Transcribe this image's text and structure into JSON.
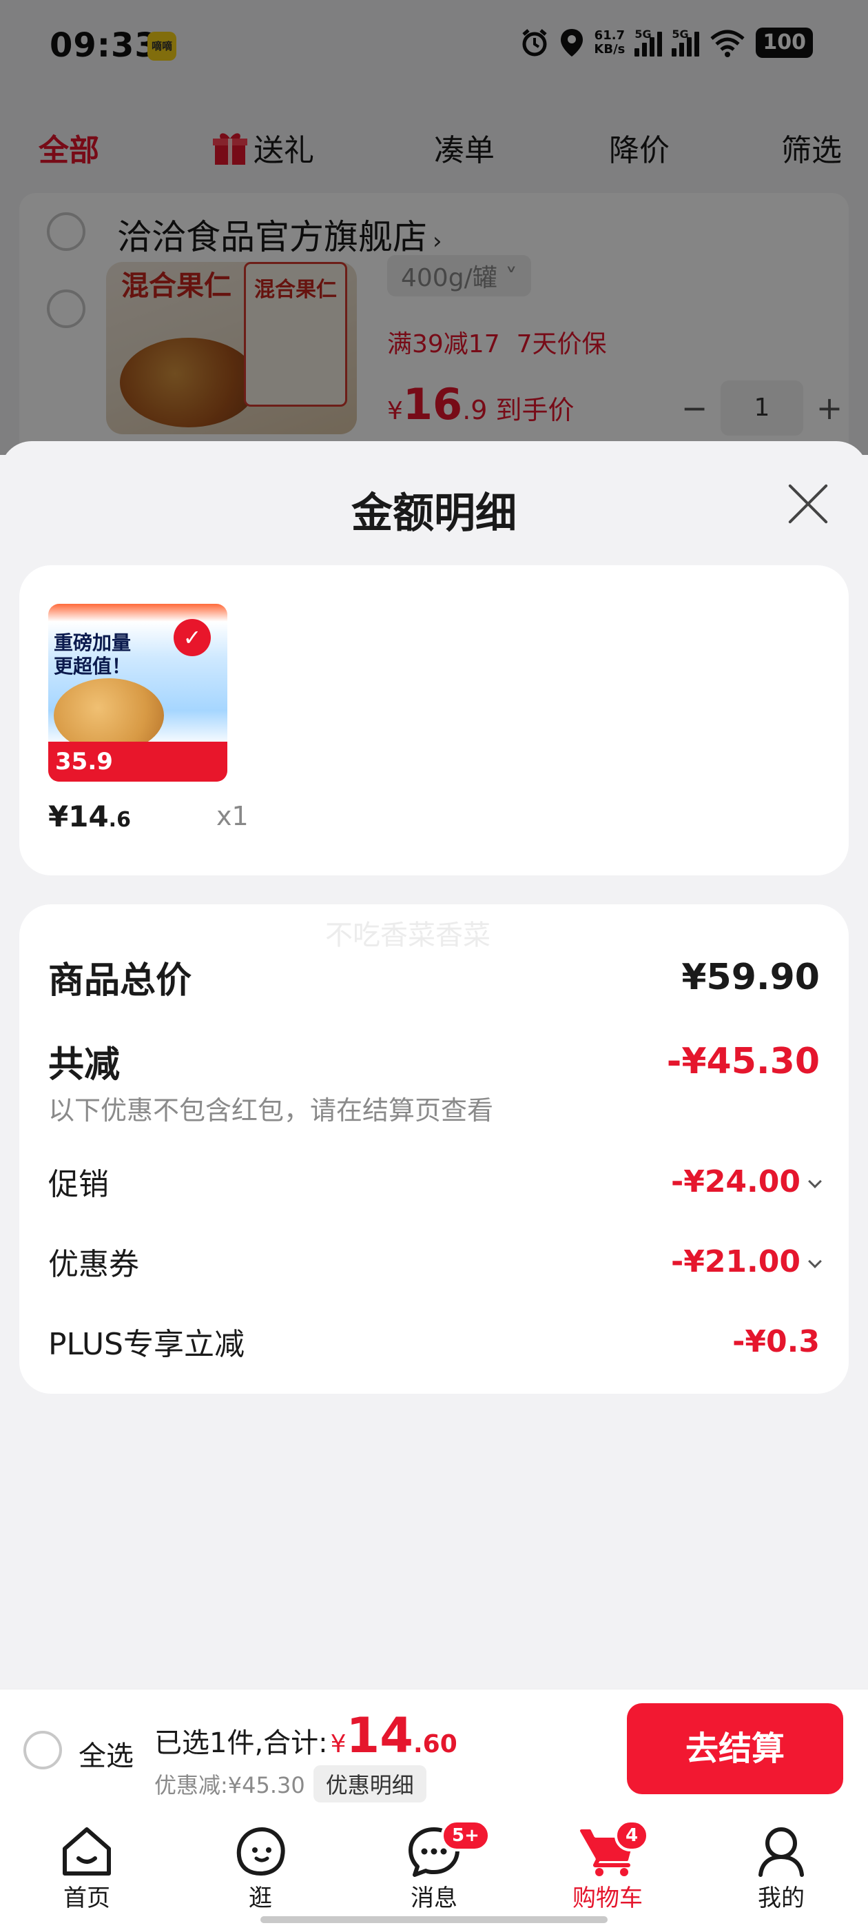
{
  "status_bar": {
    "time": "09:33",
    "app_icon_text": "嘀嘀",
    "net_speed_value": "61.7",
    "net_speed_unit": "KB/s",
    "sim1": "5G",
    "sim2": "5G",
    "battery": "100"
  },
  "filters": {
    "all": "全部",
    "gift": "送礼",
    "bundle": "凑单",
    "price_drop": "降价",
    "screen": "筛选"
  },
  "cart": {
    "store_name": "洽洽食品官方旗舰店",
    "product_image_text": "混合果仁",
    "product_jar_text": "混合果仁",
    "spec": "400g/罐",
    "promo": "满39减17",
    "price_protect": "7天价保",
    "price_currency": "¥",
    "price_int": "16",
    "price_dec": ".9",
    "price_tag": "到手价",
    "quantity": "1"
  },
  "sheet": {
    "title": "金额明细",
    "watermark": "不吃香菜香菜",
    "goods": {
      "thumb_headline_1": "重磅加量",
      "thumb_headline_2": "更超值！",
      "thumb_price": "35.9",
      "price_int": "¥14",
      "price_dec": ".6",
      "qty": "x1"
    },
    "total_label": "商品总价",
    "total_value": "¥59.90",
    "discount_label": "共减",
    "discount_value": "-¥45.30",
    "note": "以下优惠不包含红包，请在结算页查看",
    "promo_label": "促销",
    "promo_value": "-¥24.00",
    "coupon_label": "优惠券",
    "coupon_value": "-¥21.00",
    "plus_label": "PLUS专享立减",
    "plus_value": "-¥0.3"
  },
  "checkout": {
    "select_all": "全选",
    "selected_text": "已选1件,合计:",
    "currency": "¥",
    "total_int": "14",
    "total_dec": ".60",
    "saved_text": "优惠减:¥45.30",
    "detail_link": "优惠明细",
    "button": "去结算"
  },
  "tabbar": {
    "home": "首页",
    "browse": "逛",
    "messages": "消息",
    "messages_badge": "5+",
    "cart": "购物车",
    "cart_badge": "4",
    "me": "我的"
  },
  "colors": {
    "accent_red": "#e5162d",
    "button_red": "#f21831"
  }
}
